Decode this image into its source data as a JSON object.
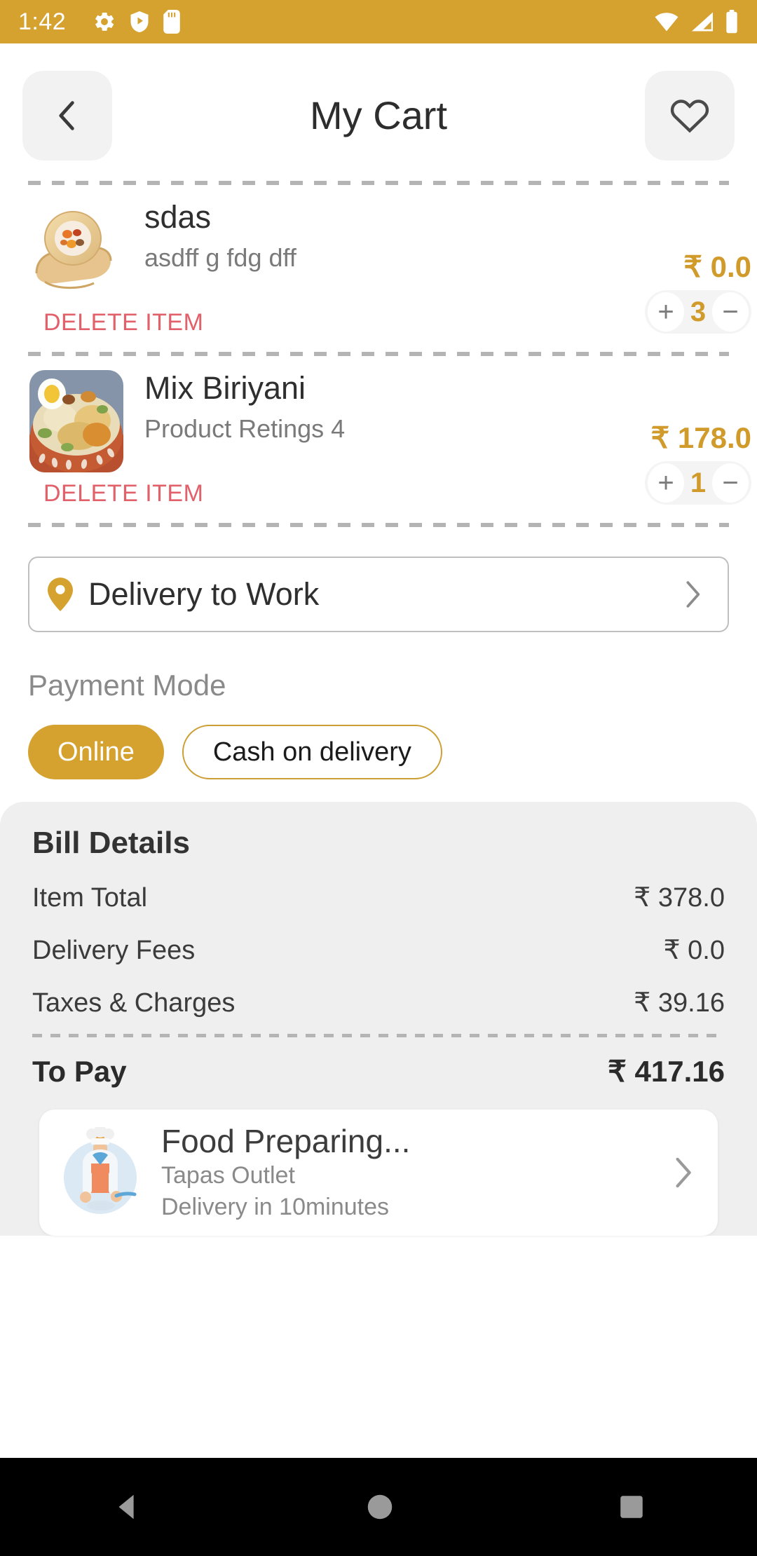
{
  "status_bar": {
    "time": "1:42",
    "left_icons": [
      "settings-gear-icon",
      "play-protect-icon",
      "sd-card-icon"
    ],
    "right_icons": [
      "wifi-icon",
      "signal-icon",
      "battery-icon"
    ],
    "background_color": "#d5a12f"
  },
  "app_bar": {
    "title": "My Cart",
    "back_icon": "chevron-left-icon",
    "favorite_icon": "heart-icon"
  },
  "cart_items": [
    {
      "name": "sdas",
      "subtitle": "asdff g fdg dff",
      "price": "₹ 0.0",
      "quantity": "3",
      "delete_label": "DELETE ITEM",
      "increment_label": "+",
      "decrement_label": "−",
      "thumbnail": "spring-roll-photo"
    },
    {
      "name": "Mix Biriyani",
      "subtitle": "Product Retings 4",
      "price": "₹ 178.0",
      "quantity": "1",
      "delete_label": "DELETE ITEM",
      "increment_label": "+",
      "decrement_label": "−",
      "thumbnail": "biriyani-bowl-photo"
    }
  ],
  "delivery": {
    "label": "Delivery to Work",
    "pin_icon": "location-pin-icon",
    "chevron_icon": "chevron-right-icon"
  },
  "payment": {
    "section_label": "Payment Mode",
    "options": [
      {
        "label": "Online",
        "selected": true
      },
      {
        "label": "Cash on delivery",
        "selected": false
      }
    ]
  },
  "bill": {
    "title": "Bill Details",
    "rows": [
      {
        "label": "Item Total",
        "value": "₹ 378.0"
      },
      {
        "label": "Delivery Fees",
        "value": "₹ 0.0"
      },
      {
        "label": "Taxes & Charges",
        "value": "₹ 39.16"
      }
    ],
    "total_label": "To Pay",
    "total_value": "₹ 417.16"
  },
  "order_status": {
    "title": "Food Preparing...",
    "outlet": "Tapas Outlet",
    "eta": "Delivery in 10minutes",
    "illustration": "chef-cooking-illustration",
    "chevron_icon": "chevron-right-icon"
  },
  "nav_bar": {
    "back_icon": "nav-back-triangle-icon",
    "home_icon": "nav-home-circle-icon",
    "recents_icon": "nav-recents-square-icon"
  },
  "colors": {
    "accent": "#d5a12f",
    "price": "#d19b2c",
    "delete": "#e2606a",
    "bill_bg": "#efefef"
  }
}
